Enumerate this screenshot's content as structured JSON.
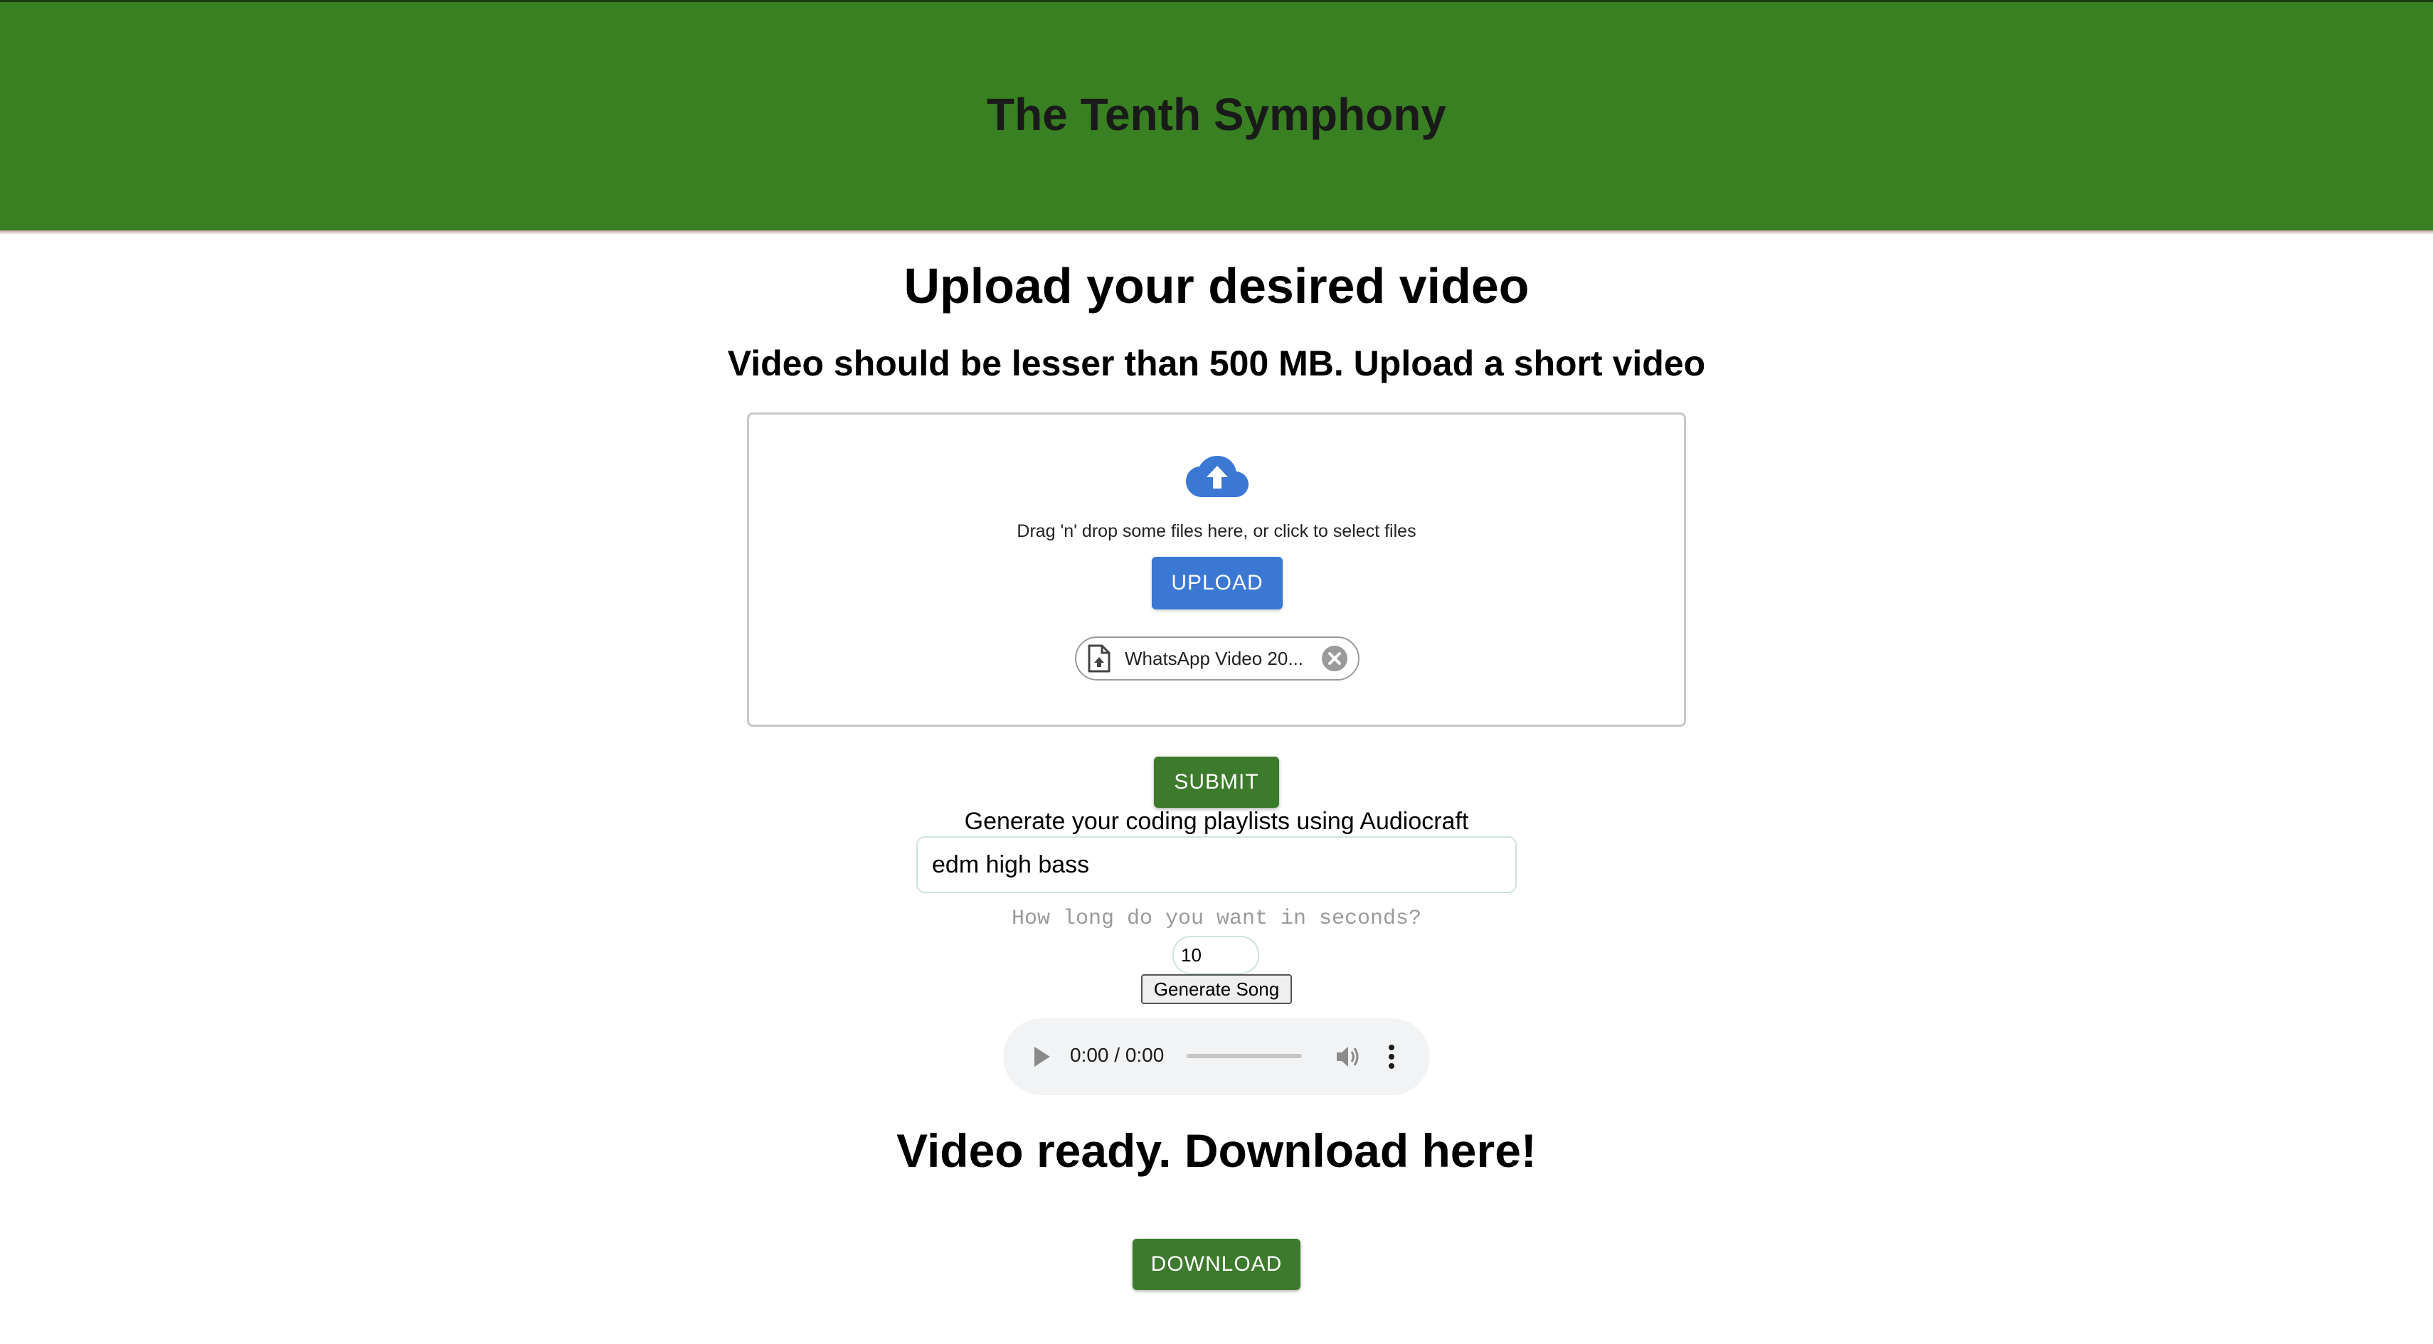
{
  "header": {
    "title": "The Tenth Symphony"
  },
  "upload": {
    "heading": "Upload your desired video",
    "subheading": "Video should be lesser than 500 MB. Upload a short video",
    "dropzone_text": "Drag 'n' drop some files here, or click to select files",
    "upload_label": "UPLOAD",
    "file_chip": "WhatsApp Video 20...",
    "cloud_icon": "cloud-upload-icon",
    "file_icon": "file-upload-icon",
    "remove_icon": "remove-circle-icon"
  },
  "submit_label": "SUBMIT",
  "generator": {
    "caption": "Generate your coding playlists using Audiocraft",
    "prompt_value": "edm high bass",
    "duration_label": "How long do you want in seconds?",
    "duration_value": "10",
    "generate_label": "Generate Song"
  },
  "audio": {
    "time": "0:00 / 0:00"
  },
  "download": {
    "heading": "Video ready. Download here!",
    "label": "DOWNLOAD"
  },
  "colors": {
    "header_bg": "#388022",
    "upload_button": "#3a78d4",
    "action_button": "#3c7a2c"
  }
}
